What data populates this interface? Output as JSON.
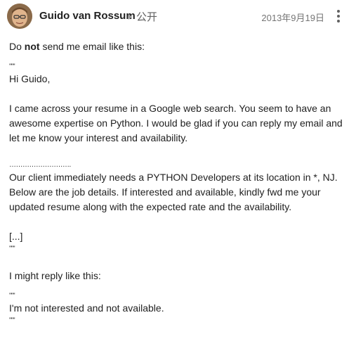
{
  "post": {
    "author": "Guido van Rossum",
    "visibility": "公开",
    "date": "2013年9月19日",
    "icons": {
      "avatar": "author-avatar",
      "visibility": "triangle-right-icon",
      "menu": "more-vert-icon"
    },
    "body": {
      "intro_before": "Do ",
      "intro_bold": "not",
      "intro_after": " send me email like this:",
      "quote_open": "\"\"\"",
      "greeting": "Hi Guido,",
      "para1": "I came across your resume in a Google web search. You seem to have an awesome expertise on Python. I would be glad if you can reply my email and let me know your interest and availability.",
      "dots": "……………………….",
      "para2": "Our client immediately needs a PYTHON Developers at its location in *, NJ. Below are the job details. If interested and available, kindly fwd me your updated resume along with the expected rate and the availability.",
      "ellipsis": "[...]",
      "quote_close": "\"\"\"",
      "reply_intro": "I might reply like this:",
      "reply_open": "\"\"\"",
      "reply": "I'm not interested and not available.",
      "reply_close": "\"\"\""
    }
  }
}
